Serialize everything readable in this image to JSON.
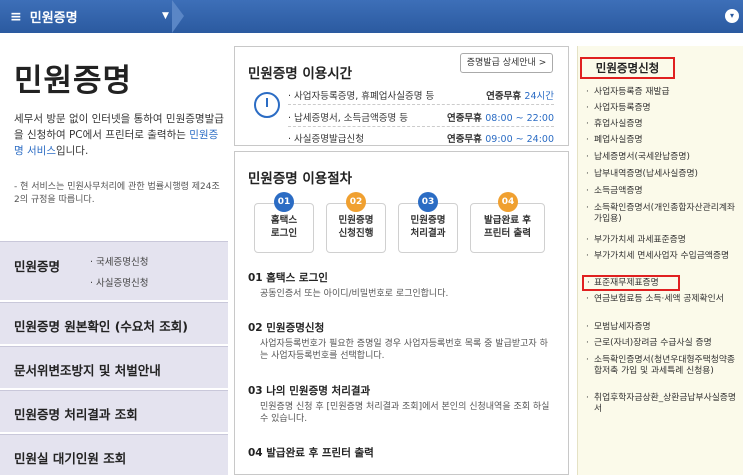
{
  "topbar": {
    "menu_label": "민원증명"
  },
  "left": {
    "title": "민원증명",
    "intro_part1": "세무서 방문 없이 인터넷을 통하여 민원증명발급을 신청하여 PC에서 프린터로 출력하는 ",
    "intro_link": "민원증명 서비스",
    "intro_part2": "입니다.",
    "note": "- 현 서비스는 민원사무처리에 관한 법률시행령 제24조2의 규정을 따릅니다.",
    "nav": [
      {
        "label": "민원증명",
        "subs": [
          "국세증명신청",
          "사실증명신청"
        ]
      },
      {
        "label": "민원증명 원본확인 (수요처 조회)"
      },
      {
        "label": "문서위변조방지 및 처벌안내"
      },
      {
        "label": "민원증명 처리결과 조회"
      },
      {
        "label": "민원실 대기인원 조회"
      }
    ]
  },
  "hours": {
    "title": "민원증명 이용시간",
    "detail_button": "증명발급 상세안내 >",
    "rows": [
      {
        "label": "사업자등록증명, 휴폐업사실증명 등",
        "prefix": "연중무휴 ",
        "time": "24시간"
      },
      {
        "label": "납세증명서, 소득금액증명 등",
        "prefix": "연중무휴 ",
        "time": "08:00 ~ 22:00"
      },
      {
        "label": "사실증명발급신청",
        "prefix": "연중무휴 ",
        "time": "09:00 ~ 24:00"
      }
    ]
  },
  "procedure": {
    "title": "민원증명 이용절차",
    "steps": [
      {
        "num": "01",
        "line1": "홈택스",
        "line2": "로그인"
      },
      {
        "num": "02",
        "line1": "민원증명",
        "line2": "신청진행"
      },
      {
        "num": "03",
        "line1": "민원증명",
        "line2": "처리결과"
      },
      {
        "num": "04",
        "line1": "발급완료 후",
        "line2": "프린터 출력"
      }
    ],
    "details": [
      {
        "heading": "01 홈택스 로그인",
        "desc": "공동인증서 또는 아이디/비밀번호로 로그인합니다."
      },
      {
        "heading": "02 민원증명신청",
        "desc": "사업자등록번호가 필요한 증명일 경우 사업자등록번호 목록 중 발급받고자 하는 사업자등록번호를 선택합니다."
      },
      {
        "heading": "03 나의 민원증명 처리결과",
        "desc": "민원증명 신청 후 [민원증명 처리결과 조회]에서 본인의 신청내역을 조회 하실 수 있습니다."
      },
      {
        "heading": "04 발급완료 후 프린터 출력",
        "desc": ""
      }
    ],
    "colors": {
      "blue": "#2b6cc4",
      "orange": "#f0a030"
    }
  },
  "right_panel": {
    "title": "민원증명신청",
    "items": [
      "사업자등록증 재발급",
      "사업자등록증명",
      "휴업사실증명",
      "폐업사실증명",
      "납세증명서(국세완납증명)",
      "납부내역증명(납세사실증명)",
      "소득금액증명",
      "소득확인증명서(개인종합자산관리계좌 가입용)",
      "부가가치세 과세표준증명",
      "부가가치세 면세사업자 수입금액증명",
      "표준재무제표증명",
      "연금보험료등 소득·세액 공제확인서",
      "모범납세자증명",
      "근로(자녀)장려금 수급사실 증명",
      "소득확인증명서(청년우대형주택청약종합저축 가입 및 과세특례 신청용)",
      "취업후학자금상환_상환금납부사실증명서"
    ]
  }
}
